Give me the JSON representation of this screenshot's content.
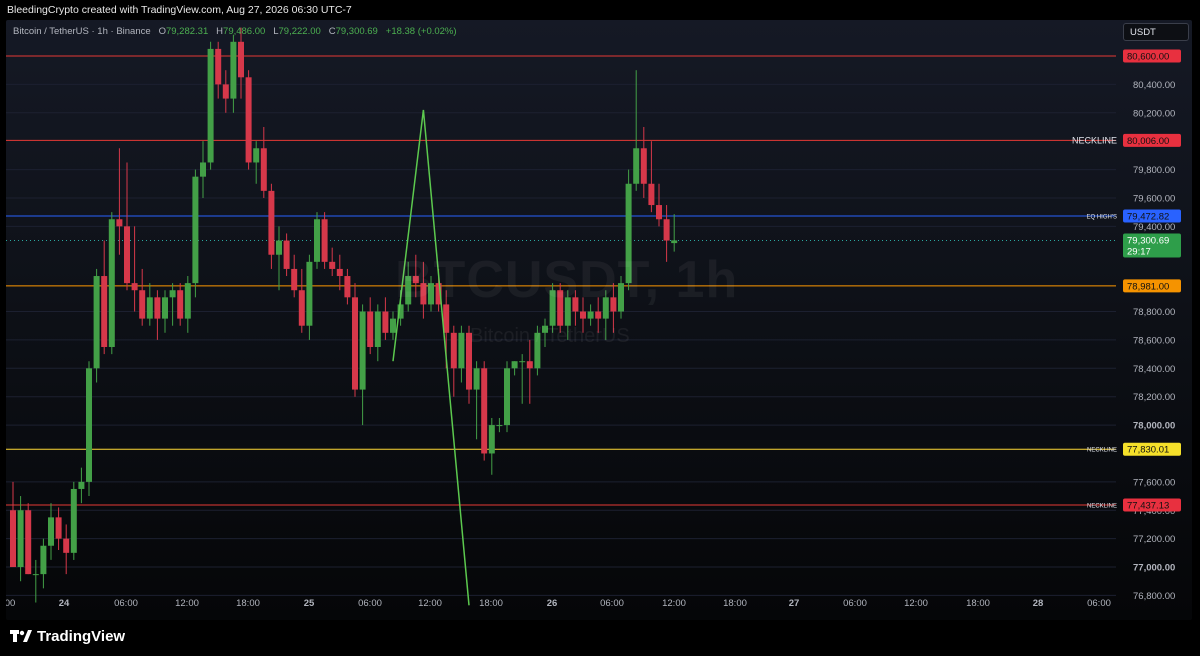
{
  "header": {
    "attribution": "BleedingCrypto created with TradingView.com, Aug 27, 2026 06:30 UTC-7"
  },
  "legend": {
    "symbol": "Bitcoin / TetherUS · 1h · Binance",
    "open_label": "O",
    "open": "79,282.31",
    "high_label": "H",
    "high": "79,486.00",
    "low_label": "L",
    "low": "79,222.00",
    "close_label": "C",
    "close": "79,300.69",
    "change": "+18.38 (+0.02%)"
  },
  "currency_button": "USDT",
  "watermark": {
    "ticker": "BTCUSDT, 1h",
    "name": "Bitcoin / TetherUS"
  },
  "footer": {
    "brand": "TradingView"
  },
  "colors": {
    "up": "#43a047",
    "down": "#d6384a",
    "red_line": "#e53935",
    "blue_line": "#2962ff",
    "orange_line": "#ff9800",
    "yellow_line": "#fdd835",
    "pattern_line": "#5cc94e"
  },
  "chart_data": {
    "type": "candlestick",
    "instrument": "Bitcoin / TetherUS",
    "interval": "1h",
    "ylim": [
      76700,
      80750
    ],
    "y_ticks": [
      "80,400.00",
      "80,200.00",
      "79,800.00",
      "79,600.00",
      "79,400.00",
      "78,800.00",
      "78,600.00",
      "78,400.00",
      "78,200.00",
      "78,000.00",
      "77,600.00",
      "77,400.00",
      "77,200.00",
      "77,000.00",
      "76,800.00"
    ],
    "y_tick_values": [
      80400,
      80200,
      79800,
      79600,
      79400,
      78800,
      78600,
      78400,
      78200,
      78000,
      77600,
      77400,
      77200,
      77000,
      76800
    ],
    "x_ticks": [
      "00",
      "24",
      "06:00",
      "12:00",
      "18:00",
      "25",
      "06:00",
      "12:00",
      "18:00",
      "26",
      "06:00",
      "12:00",
      "18:00",
      "27",
      "06:00",
      "12:00",
      "18:00",
      "28",
      "06:00"
    ],
    "x_tick_bold": [
      false,
      true,
      false,
      false,
      false,
      true,
      false,
      false,
      false,
      true,
      false,
      false,
      false,
      true,
      false,
      false,
      false,
      true,
      false
    ],
    "levels": [
      {
        "price": 80600.0,
        "label": "80,600.00",
        "color": "red",
        "text": ""
      },
      {
        "price": 80006.0,
        "label": "80,006.00",
        "color": "red",
        "text": "NECKLINE"
      },
      {
        "price": 79472.82,
        "label": "79,472.82",
        "color": "blue",
        "text": "EQ HIGH'S"
      },
      {
        "price": 78981.0,
        "label": "78,981.00",
        "color": "orange",
        "text": ""
      },
      {
        "price": 77830.01,
        "label": "77,830.01",
        "color": "yellow",
        "text": "NECKLINE"
      },
      {
        "price": 77437.13,
        "label": "77,437.13",
        "color": "red",
        "text": "NECKLINE"
      }
    ],
    "last_price": {
      "price": 79300.69,
      "label": "79,300.69",
      "countdown": "29:17"
    },
    "pattern_line": [
      {
        "bar": 50,
        "price": 78450
      },
      {
        "bar": 54,
        "price": 80220
      },
      {
        "bar": 60,
        "price": 76730
      }
    ],
    "candles": [
      {
        "o": 77400,
        "h": 77600,
        "l": 77000,
        "c": 77000
      },
      {
        "o": 77000,
        "h": 77500,
        "l": 76900,
        "c": 77400
      },
      {
        "o": 77400,
        "h": 77450,
        "l": 76950,
        "c": 76950
      },
      {
        "o": 76950,
        "h": 77050,
        "l": 76750,
        "c": 76950
      },
      {
        "o": 76950,
        "h": 77200,
        "l": 76850,
        "c": 77150
      },
      {
        "o": 77150,
        "h": 77450,
        "l": 77050,
        "c": 77350
      },
      {
        "o": 77350,
        "h": 77420,
        "l": 77120,
        "c": 77200
      },
      {
        "o": 77200,
        "h": 77300,
        "l": 76950,
        "c": 77100
      },
      {
        "o": 77100,
        "h": 77600,
        "l": 77050,
        "c": 77550
      },
      {
        "o": 77550,
        "h": 77700,
        "l": 77450,
        "c": 77600
      },
      {
        "o": 77600,
        "h": 78450,
        "l": 77500,
        "c": 78400
      },
      {
        "o": 78400,
        "h": 79100,
        "l": 78300,
        "c": 79050
      },
      {
        "o": 79050,
        "h": 79300,
        "l": 78500,
        "c": 78550
      },
      {
        "o": 78550,
        "h": 79500,
        "l": 78500,
        "c": 79450
      },
      {
        "o": 79450,
        "h": 79950,
        "l": 79200,
        "c": 79400
      },
      {
        "o": 79400,
        "h": 79850,
        "l": 78950,
        "c": 79000
      },
      {
        "o": 79000,
        "h": 79400,
        "l": 78800,
        "c": 78950
      },
      {
        "o": 78950,
        "h": 79100,
        "l": 78700,
        "c": 78750
      },
      {
        "o": 78750,
        "h": 79000,
        "l": 78700,
        "c": 78900
      },
      {
        "o": 78900,
        "h": 78950,
        "l": 78600,
        "c": 78750
      },
      {
        "o": 78750,
        "h": 78950,
        "l": 78650,
        "c": 78900
      },
      {
        "o": 78900,
        "h": 79000,
        "l": 78700,
        "c": 78950
      },
      {
        "o": 78950,
        "h": 79000,
        "l": 78700,
        "c": 78750
      },
      {
        "o": 78750,
        "h": 79050,
        "l": 78650,
        "c": 79000
      },
      {
        "o": 79000,
        "h": 79800,
        "l": 78900,
        "c": 79750
      },
      {
        "o": 79750,
        "h": 80000,
        "l": 79600,
        "c": 79850
      },
      {
        "o": 79850,
        "h": 80700,
        "l": 79800,
        "c": 80650
      },
      {
        "o": 80650,
        "h": 80700,
        "l": 80300,
        "c": 80400
      },
      {
        "o": 80400,
        "h": 80500,
        "l": 80200,
        "c": 80300
      },
      {
        "o": 80300,
        "h": 80750,
        "l": 80200,
        "c": 80700
      },
      {
        "o": 80700,
        "h": 80800,
        "l": 80300,
        "c": 80450
      },
      {
        "o": 80450,
        "h": 80500,
        "l": 79800,
        "c": 79850
      },
      {
        "o": 79850,
        "h": 80000,
        "l": 79700,
        "c": 79950
      },
      {
        "o": 79950,
        "h": 80100,
        "l": 79600,
        "c": 79650
      },
      {
        "o": 79650,
        "h": 79700,
        "l": 79100,
        "c": 79200
      },
      {
        "o": 79200,
        "h": 79400,
        "l": 78950,
        "c": 79300
      },
      {
        "o": 79300,
        "h": 79350,
        "l": 79050,
        "c": 79100
      },
      {
        "o": 79100,
        "h": 79200,
        "l": 78900,
        "c": 78950
      },
      {
        "o": 78950,
        "h": 79100,
        "l": 78650,
        "c": 78700
      },
      {
        "o": 78700,
        "h": 79200,
        "l": 78600,
        "c": 79150
      },
      {
        "o": 79150,
        "h": 79500,
        "l": 79100,
        "c": 79450
      },
      {
        "o": 79450,
        "h": 79500,
        "l": 79100,
        "c": 79150
      },
      {
        "o": 79150,
        "h": 79250,
        "l": 79050,
        "c": 79100
      },
      {
        "o": 79100,
        "h": 79200,
        "l": 78950,
        "c": 79050
      },
      {
        "o": 79050,
        "h": 79100,
        "l": 78850,
        "c": 78900
      },
      {
        "o": 78900,
        "h": 79000,
        "l": 78200,
        "c": 78250
      },
      {
        "o": 78250,
        "h": 78850,
        "l": 78000,
        "c": 78800
      },
      {
        "o": 78800,
        "h": 78900,
        "l": 78500,
        "c": 78550
      },
      {
        "o": 78550,
        "h": 78850,
        "l": 78450,
        "c": 78800
      },
      {
        "o": 78800,
        "h": 78900,
        "l": 78600,
        "c": 78650
      },
      {
        "o": 78650,
        "h": 78800,
        "l": 78600,
        "c": 78750
      },
      {
        "o": 78750,
        "h": 78950,
        "l": 78700,
        "c": 78850
      },
      {
        "o": 78850,
        "h": 79150,
        "l": 78800,
        "c": 79050
      },
      {
        "o": 79050,
        "h": 79200,
        "l": 78900,
        "c": 79000
      },
      {
        "o": 79000,
        "h": 79150,
        "l": 78750,
        "c": 78850
      },
      {
        "o": 78850,
        "h": 79050,
        "l": 78800,
        "c": 79000
      },
      {
        "o": 79000,
        "h": 79100,
        "l": 78800,
        "c": 78850
      },
      {
        "o": 78850,
        "h": 78950,
        "l": 78400,
        "c": 78650
      },
      {
        "o": 78650,
        "h": 78700,
        "l": 78200,
        "c": 78400
      },
      {
        "o": 78400,
        "h": 78700,
        "l": 78300,
        "c": 78650
      },
      {
        "o": 78650,
        "h": 78700,
        "l": 78150,
        "c": 78250
      },
      {
        "o": 78250,
        "h": 78450,
        "l": 77900,
        "c": 78400
      },
      {
        "o": 78400,
        "h": 78450,
        "l": 77750,
        "c": 77800
      },
      {
        "o": 77800,
        "h": 78050,
        "l": 77650,
        "c": 78000
      },
      {
        "o": 78000,
        "h": 78050,
        "l": 77950,
        "c": 78000
      },
      {
        "o": 78000,
        "h": 78450,
        "l": 77950,
        "c": 78400
      },
      {
        "o": 78400,
        "h": 78450,
        "l": 78350,
        "c": 78450
      },
      {
        "o": 78450,
        "h": 78500,
        "l": 78150,
        "c": 78450
      },
      {
        "o": 78450,
        "h": 78600,
        "l": 78150,
        "c": 78400
      },
      {
        "o": 78400,
        "h": 78700,
        "l": 78350,
        "c": 78650
      },
      {
        "o": 78650,
        "h": 78750,
        "l": 78550,
        "c": 78700
      },
      {
        "o": 78700,
        "h": 79000,
        "l": 78650,
        "c": 78950
      },
      {
        "o": 78950,
        "h": 79000,
        "l": 78650,
        "c": 78700
      },
      {
        "o": 78700,
        "h": 78950,
        "l": 78600,
        "c": 78900
      },
      {
        "o": 78900,
        "h": 78950,
        "l": 78700,
        "c": 78800
      },
      {
        "o": 78800,
        "h": 78900,
        "l": 78650,
        "c": 78750
      },
      {
        "o": 78750,
        "h": 78850,
        "l": 78700,
        "c": 78800
      },
      {
        "o": 78800,
        "h": 78900,
        "l": 78650,
        "c": 78750
      },
      {
        "o": 78750,
        "h": 78950,
        "l": 78600,
        "c": 78900
      },
      {
        "o": 78900,
        "h": 79000,
        "l": 78650,
        "c": 78800
      },
      {
        "o": 78800,
        "h": 79050,
        "l": 78750,
        "c": 79000
      },
      {
        "o": 79000,
        "h": 79800,
        "l": 78950,
        "c": 79700
      },
      {
        "o": 79700,
        "h": 80500,
        "l": 79650,
        "c": 79950
      },
      {
        "o": 79950,
        "h": 80100,
        "l": 79600,
        "c": 79700
      },
      {
        "o": 79700,
        "h": 80000,
        "l": 79500,
        "c": 79550
      },
      {
        "o": 79550,
        "h": 79700,
        "l": 79400,
        "c": 79450
      },
      {
        "o": 79450,
        "h": 79550,
        "l": 79150,
        "c": 79300
      },
      {
        "o": 79282,
        "h": 79486,
        "l": 79222,
        "c": 79301
      }
    ]
  }
}
